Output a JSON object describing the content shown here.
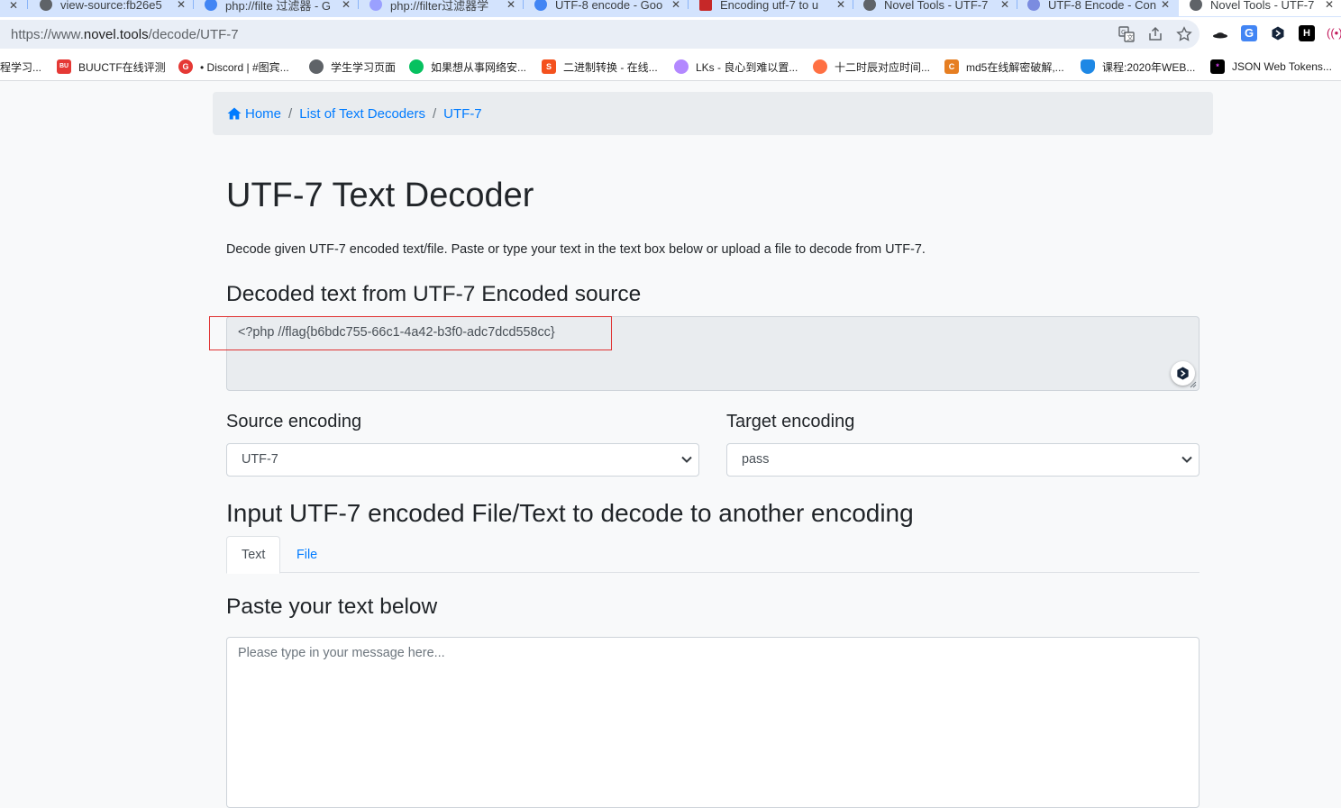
{
  "browser": {
    "tabs": [
      {
        "title": "view-source:fb26e5",
        "favicon_color": "#5f6368"
      },
      {
        "title": "php://filte 过滤器 - G",
        "favicon_color": "#4285f4"
      },
      {
        "title": "php://filter过滤器学",
        "favicon_color": "#9aa0ff"
      },
      {
        "title": "UTF-8 encode - Goo",
        "favicon_color": "#4285f4"
      },
      {
        "title": "Encoding utf-7 to u",
        "favicon_color": "#c62828"
      },
      {
        "title": "Novel Tools - UTF-7",
        "favicon_color": "#5f6368"
      },
      {
        "title": "UTF-8 Encode - Con",
        "favicon_color": "#7b8ce0"
      },
      {
        "title": "Novel Tools - UTF-7",
        "favicon_color": "#5f6368"
      }
    ],
    "url_prefix": "https://www.",
    "url_domain": "novel.tools",
    "url_path": "/decode/UTF-7",
    "bookmarks": [
      {
        "label": "程学习...",
        "icon_color": "#ffffff",
        "icon_text": ""
      },
      {
        "label": "BUUCTF在线评测",
        "icon_color": "#e53935",
        "icon_text": "BU"
      },
      {
        "label": "• Discord | #图宾...",
        "icon_color": "#e53935",
        "icon_text": "G"
      },
      {
        "label": "学生学习页面",
        "icon_color": "#5f6368",
        "icon_text": ""
      },
      {
        "label": "如果想从事网络安...",
        "icon_color": "#07c160",
        "icon_text": ""
      },
      {
        "label": "二进制转换 - 在线...",
        "icon_color": "#f4511e",
        "icon_text": "S"
      },
      {
        "label": "LKs - 良心到难以置...",
        "icon_color": "#b388ff",
        "icon_text": ""
      },
      {
        "label": "十二时辰对应时间...",
        "icon_color": "#ff7043",
        "icon_text": ""
      },
      {
        "label": "md5在线解密破解,...",
        "icon_color": "#e67e22",
        "icon_text": "C"
      },
      {
        "label": "课程:2020年WEB...",
        "icon_color": "#1e88e5",
        "icon_text": ""
      },
      {
        "label": "JSON Web Tokens...",
        "icon_color": "#000000",
        "icon_text": "*"
      }
    ]
  },
  "breadcrumb": {
    "home": "Home",
    "list": "List of Text Decoders",
    "current": "UTF-7"
  },
  "page": {
    "title": "UTF-7 Text Decoder",
    "lead": "Decode given UTF-7 encoded text/file. Paste or type your text in the text box below or upload a file to decode from UTF-7.",
    "output_heading": "Decoded text from UTF-7 Encoded source",
    "output_value": "<?php //flag{b6bdc755-66c1-4a42-b3f0-adc7dcd558cc}",
    "source_label": "Source encoding",
    "source_value": "UTF-7",
    "target_label": "Target encoding",
    "target_value": "pass",
    "input_heading": "Input UTF-7 encoded File/Text to decode to another encoding",
    "tab_text": "Text",
    "tab_file": "File",
    "paste_heading": "Paste your text below",
    "input_placeholder": "Please type in your message here..."
  },
  "colors": {
    "link": "#007bff",
    "highlight_box": "#e03131",
    "breadcrumb_bg": "#e9ecef"
  }
}
